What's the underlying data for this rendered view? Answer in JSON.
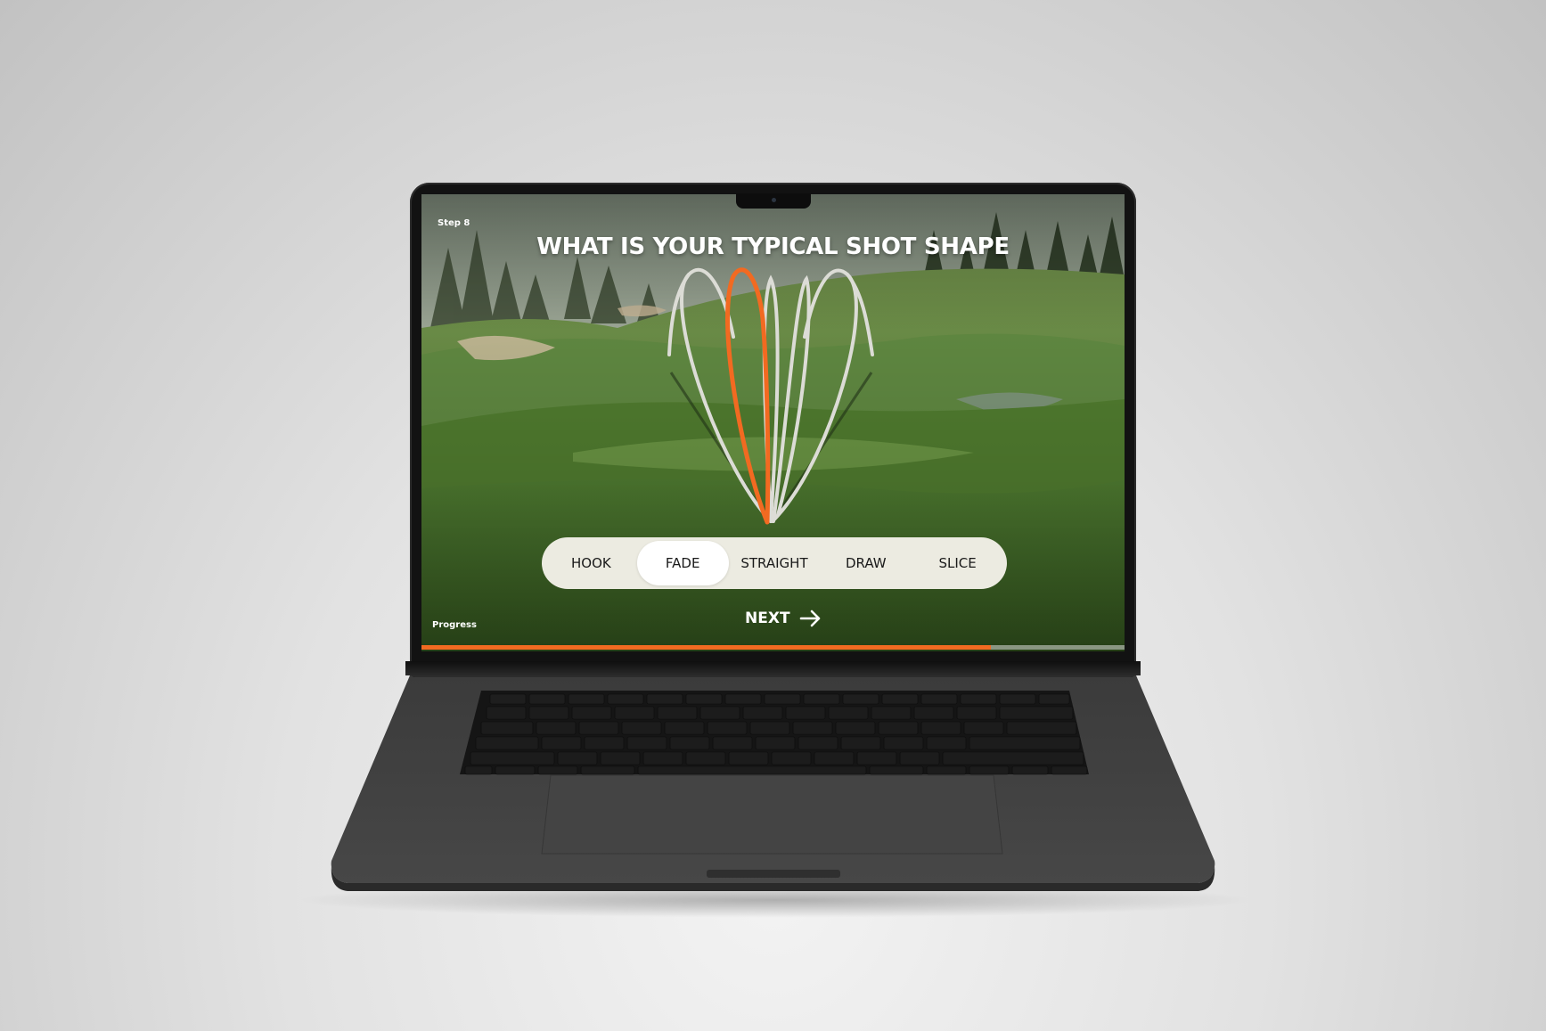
{
  "step": {
    "label": "Step 8"
  },
  "question": {
    "title": "WHAT IS YOUR TYPICAL SHOT SHAPE"
  },
  "shape_options": [
    {
      "label": "HOOK",
      "selected": false
    },
    {
      "label": "FADE",
      "selected": true
    },
    {
      "label": "STRAIGHT",
      "selected": false
    },
    {
      "label": "DRAW",
      "selected": false
    },
    {
      "label": "SLICE",
      "selected": false
    }
  ],
  "next": {
    "label": "NEXT",
    "icon": "arrow-right-icon"
  },
  "progress": {
    "label": "Progress",
    "fraction": 0.81
  },
  "colors": {
    "accent": "#f26a21",
    "pill_background": "#ecebe1",
    "selected_pill": "#ffffff",
    "trajectory": "#d9d9d3",
    "laptop_body": "#3a3a3a"
  }
}
